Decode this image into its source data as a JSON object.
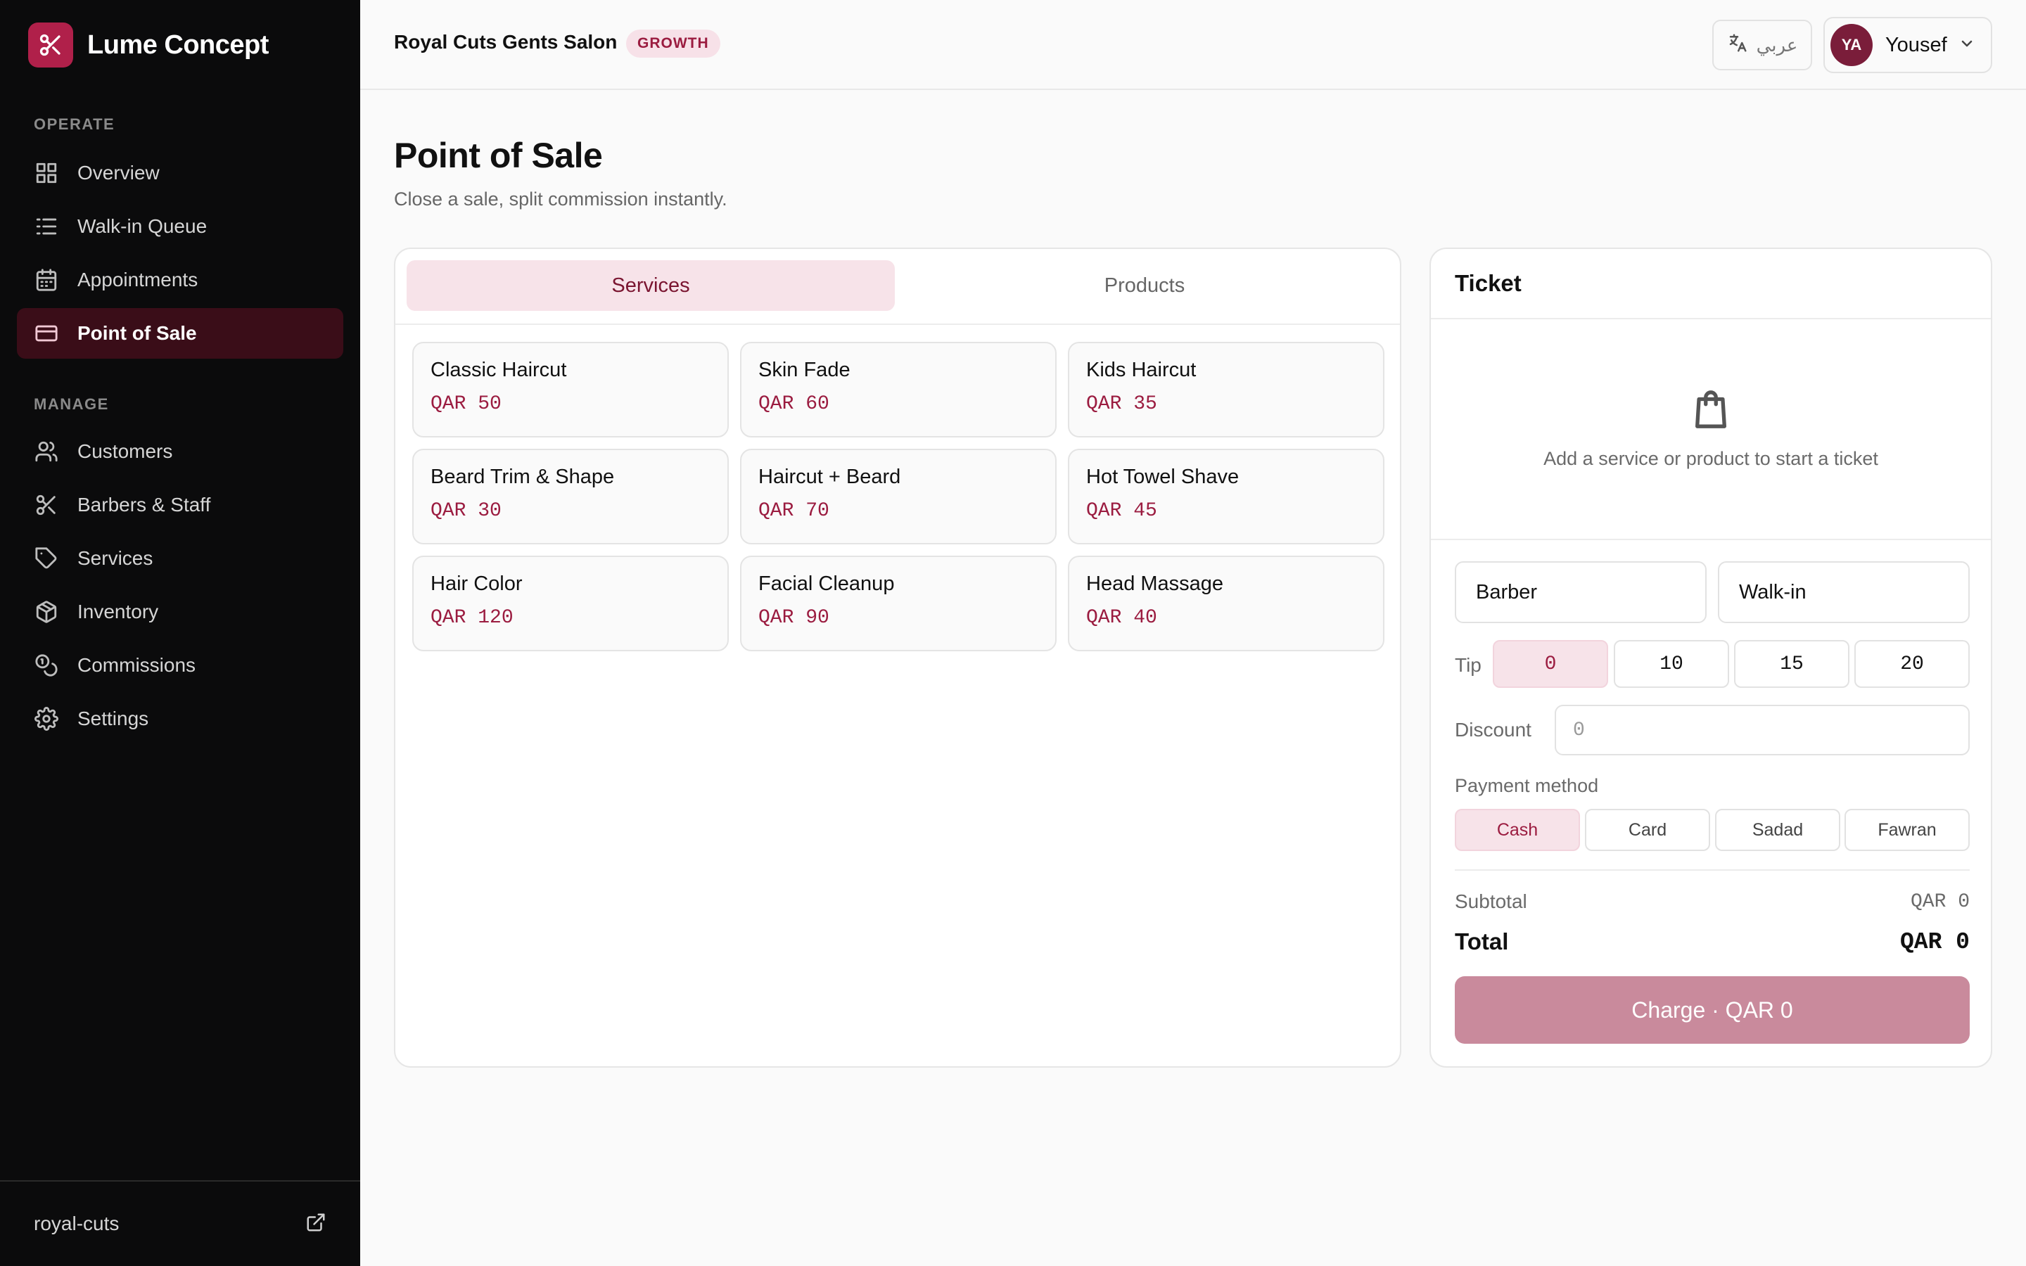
{
  "app": {
    "name": "Lume Concept",
    "logo_icon": "scissors-icon"
  },
  "sidebar": {
    "sections": [
      {
        "label": "OPERATE"
      },
      {
        "label": "MANAGE"
      }
    ],
    "items": [
      {
        "label": "Overview",
        "icon": "grid-icon"
      },
      {
        "label": "Walk-in Queue",
        "icon": "list-icon"
      },
      {
        "label": "Appointments",
        "icon": "calendar-icon"
      },
      {
        "label": "Point of Sale",
        "icon": "credit-card-icon",
        "active": true
      },
      {
        "label": "Customers",
        "icon": "users-icon"
      },
      {
        "label": "Barbers & Staff",
        "icon": "scissors-icon"
      },
      {
        "label": "Services",
        "icon": "tag-icon"
      },
      {
        "label": "Inventory",
        "icon": "package-icon"
      },
      {
        "label": "Commissions",
        "icon": "coins-icon"
      },
      {
        "label": "Settings",
        "icon": "gear-icon"
      }
    ],
    "footer": {
      "slug": "royal-cuts",
      "icon": "external-link-icon"
    }
  },
  "header": {
    "salon_name": "Royal Cuts Gents Salon",
    "plan_badge": "GROWTH",
    "language_label": "عربي",
    "user": {
      "initials": "YA",
      "name": "Yousef"
    }
  },
  "page": {
    "title": "Point of Sale",
    "subtitle": "Close a sale, split commission instantly."
  },
  "catalog": {
    "tabs": [
      {
        "label": "Services",
        "active": true
      },
      {
        "label": "Products",
        "active": false
      }
    ],
    "items": [
      {
        "name": "Classic Haircut",
        "price": "QAR 50"
      },
      {
        "name": "Skin Fade",
        "price": "QAR 60"
      },
      {
        "name": "Kids Haircut",
        "price": "QAR 35"
      },
      {
        "name": "Beard Trim & Shape",
        "price": "QAR 30"
      },
      {
        "name": "Haircut + Beard",
        "price": "QAR 70"
      },
      {
        "name": "Hot Towel Shave",
        "price": "QAR 45"
      },
      {
        "name": "Hair Color",
        "price": "QAR 120"
      },
      {
        "name": "Facial Cleanup",
        "price": "QAR 90"
      },
      {
        "name": "Head Massage",
        "price": "QAR 40"
      }
    ]
  },
  "ticket": {
    "title": "Ticket",
    "empty_message": "Add a service or product to start a ticket",
    "empty_icon": "shopping-bag-icon",
    "barber_select": "Barber",
    "customer_select": "Walk-in",
    "tip_label": "Tip",
    "tip_options": [
      "0",
      "10",
      "15",
      "20"
    ],
    "tip_selected": "0",
    "discount_label": "Discount",
    "discount_placeholder": "0",
    "payment_label": "Payment method",
    "payment_methods": [
      "Cash",
      "Card",
      "Sadad",
      "Fawran"
    ],
    "payment_selected": "Cash",
    "subtotal_label": "Subtotal",
    "subtotal_value": "QAR 0",
    "total_label": "Total",
    "total_value": "QAR 0",
    "charge_label": "Charge · QAR 0"
  },
  "colors": {
    "brand": "#b0204a",
    "accent_text": "#9b1c40",
    "accent_bg": "#f7e3e9",
    "sidebar_bg": "#0b0b0c",
    "charge_disabled": "#c98a9c"
  }
}
